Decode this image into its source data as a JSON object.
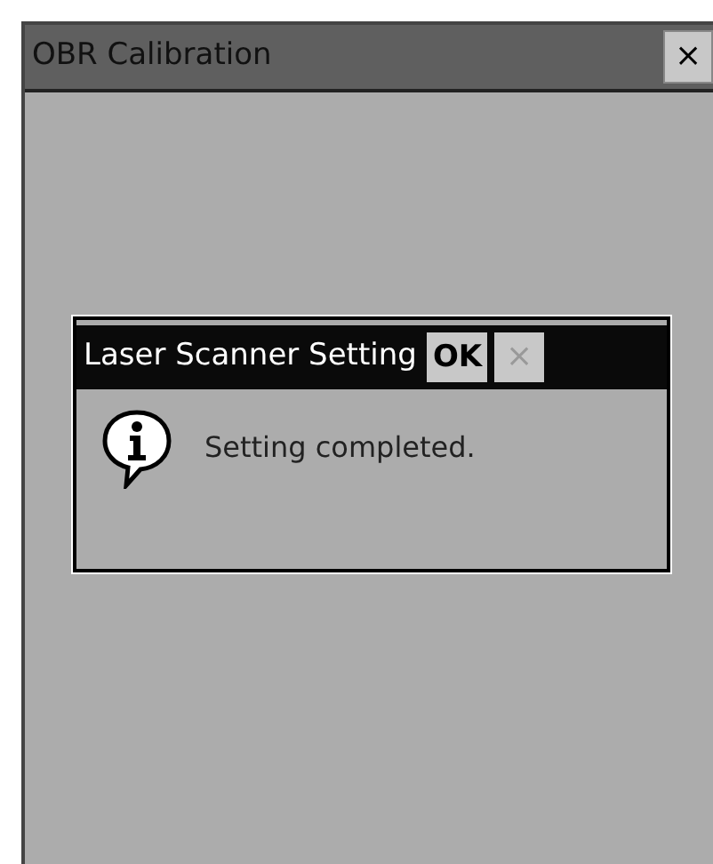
{
  "window": {
    "title": "OBR Calibration",
    "close": "×"
  },
  "dialog": {
    "title": "Laser Scanner Setting",
    "ok": "OK",
    "close": {
      "label": "×",
      "disabled": true
    },
    "message": "Setting completed."
  }
}
